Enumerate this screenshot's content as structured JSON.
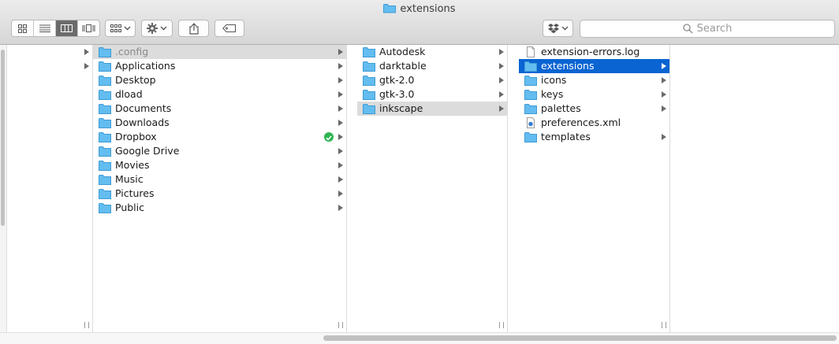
{
  "window": {
    "title": "extensions"
  },
  "toolbar": {
    "search_placeholder": "Search"
  },
  "columns": [
    {
      "items": [
        {
          "label": "",
          "arrow": true
        },
        {
          "label": "",
          "arrow": true
        }
      ]
    },
    {
      "items": [
        {
          "label": ".config",
          "icon": "folder-icon",
          "state": "gray-dim",
          "arrow": true
        },
        {
          "label": "Applications",
          "icon": "applications-folder-icon",
          "arrow": true
        },
        {
          "label": "Desktop",
          "icon": "desktop-folder-icon",
          "arrow": true
        },
        {
          "label": "dload",
          "icon": "document-folder-icon",
          "arrow": true
        },
        {
          "label": "Documents",
          "icon": "documents-folder-icon",
          "arrow": true
        },
        {
          "label": "Downloads",
          "icon": "downloads-folder-icon",
          "arrow": true
        },
        {
          "label": "Dropbox",
          "icon": "dropbox-folder-icon",
          "arrow": true,
          "synced": true
        },
        {
          "label": "Google Drive",
          "icon": "google-drive-folder-icon",
          "arrow": true
        },
        {
          "label": "Movies",
          "icon": "movies-folder-icon",
          "arrow": true
        },
        {
          "label": "Music",
          "icon": "music-folder-icon",
          "arrow": true
        },
        {
          "label": "Pictures",
          "icon": "pictures-folder-icon",
          "arrow": true
        },
        {
          "label": "Public",
          "icon": "public-folder-icon",
          "arrow": true
        }
      ]
    },
    {
      "items": [
        {
          "label": "Autodesk",
          "icon": "folder-icon",
          "arrow": true
        },
        {
          "label": "darktable",
          "icon": "folder-icon",
          "arrow": true
        },
        {
          "label": "gtk-2.0",
          "icon": "folder-icon",
          "arrow": true
        },
        {
          "label": "gtk-3.0",
          "icon": "folder-icon",
          "arrow": true
        },
        {
          "label": "inkscape",
          "icon": "folder-icon",
          "state": "gray",
          "arrow": true
        }
      ]
    },
    {
      "items": [
        {
          "label": "extension-errors.log",
          "icon": "file-icon",
          "arrow": false
        },
        {
          "label": "extensions",
          "icon": "folder-icon",
          "state": "blue",
          "arrow": true
        },
        {
          "label": "icons",
          "icon": "folder-icon",
          "arrow": true
        },
        {
          "label": "keys",
          "icon": "folder-icon",
          "arrow": true
        },
        {
          "label": "palettes",
          "icon": "folder-icon",
          "arrow": true
        },
        {
          "label": "preferences.xml",
          "icon": "xml-file-icon",
          "arrow": false
        },
        {
          "label": "templates",
          "icon": "folder-icon",
          "arrow": true
        }
      ]
    },
    {
      "items": []
    }
  ],
  "colors": {
    "selection": "#0a64d2",
    "folder": "#5cb8ef",
    "sync": "#2fb551"
  }
}
